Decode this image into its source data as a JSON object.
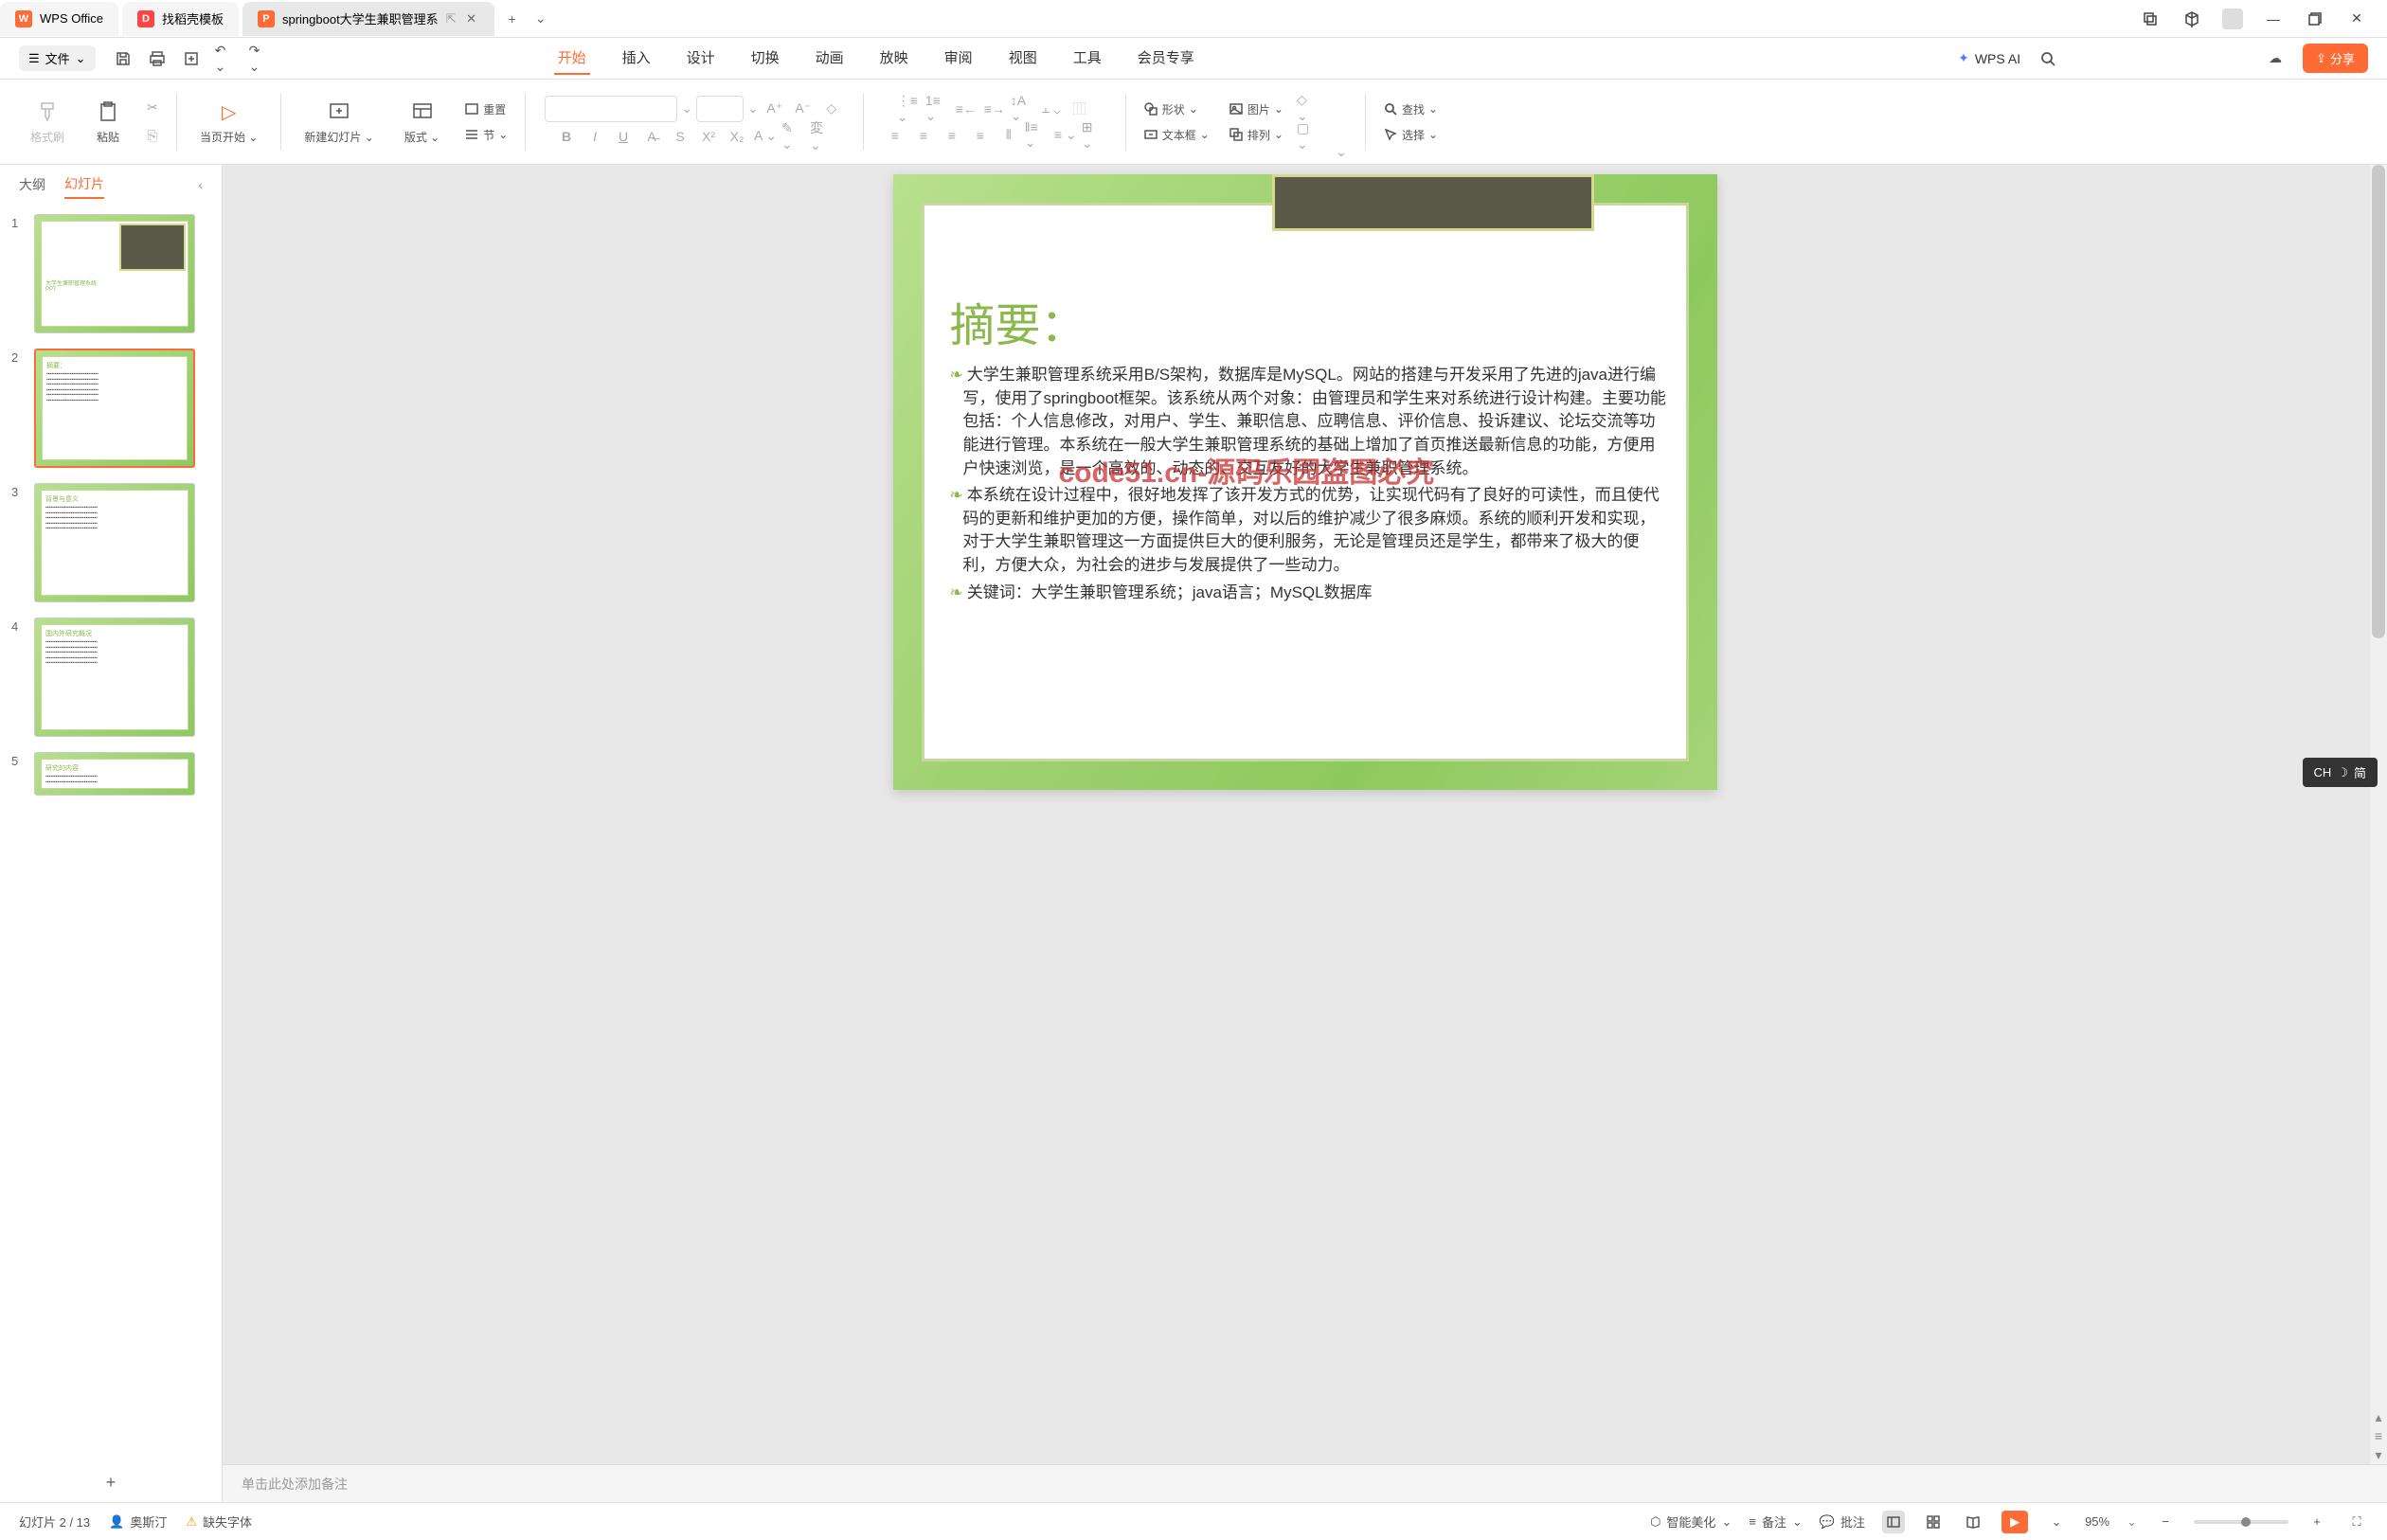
{
  "tabs": {
    "wps": "WPS Office",
    "doke": "找稻壳模板",
    "active": "springboot大学生兼职管理系",
    "new": "+"
  },
  "file_menu": "文件",
  "menutabs": {
    "start": "开始",
    "insert": "插入",
    "design": "设计",
    "transition": "切换",
    "animation": "动画",
    "slideshow": "放映",
    "review": "审阅",
    "view": "视图",
    "tools": "工具",
    "member": "会员专享"
  },
  "wps_ai": "WPS AI",
  "share_btn": "分享",
  "ribbon": {
    "formatpainter": "格式刷",
    "paste": "粘贴",
    "currentpage": "当页开始",
    "newslide": "新建幻灯片",
    "layout": "版式",
    "reset": "重置",
    "section": "节",
    "shape": "形状",
    "image": "图片",
    "textbox": "文本框",
    "arrange": "排列",
    "find": "查找",
    "select": "选择"
  },
  "sidebar": {
    "outline": "大纲",
    "slides": "幻灯片"
  },
  "thumbs": {
    "t1": {
      "title": "大学生兼职管理系统",
      "sub": "PPT"
    },
    "t2": {
      "title": "摘要："
    },
    "t3": {
      "title": "背景与意义"
    },
    "t4": {
      "title": "国内外研究概况"
    },
    "t5": {
      "title": "研究的内容"
    }
  },
  "slide": {
    "title": "摘要：",
    "p1": "大学生兼职管理系统采用B/S架构，数据库是MySQL。网站的搭建与开发采用了先进的java进行编写，使用了springboot框架。该系统从两个对象：由管理员和学生来对系统进行设计构建。主要功能包括：个人信息修改，对用户、学生、兼职信息、应聘信息、评价信息、投诉建议、论坛交流等功能进行管理。本系统在一般大学生兼职管理系统的基础上增加了首页推送最新信息的功能，方便用户快速浏览，是一个高效的、动态的、交互友好的大学生兼职管理系统。",
    "p2": "本系统在设计过程中，很好地发挥了该开发方式的优势，让实现代码有了良好的可读性，而且使代码的更新和维护更加的方便，操作简单，对以后的维护减少了很多麻烦。系统的顺利开发和实现，对于大学生兼职管理这一方面提供巨大的便利服务，无论是管理员还是学生，都带来了极大的便利，方便大众，为社会的进步与发展提供了一些动力。",
    "p3": "关键词：大学生兼职管理系统；java语言；MySQL数据库",
    "watermark": "code51.cn-源码乐园盗图必究"
  },
  "notes_placeholder": "单击此处添加备注",
  "statusbar": {
    "slide_counter": "幻灯片 2 / 13",
    "author": "奥斯汀",
    "missing_font": "缺失字体",
    "beautify": "智能美化",
    "notes": "备注",
    "comments": "批注",
    "zoom": "95%"
  },
  "ime": {
    "lang": "CH",
    "mode": "简"
  }
}
